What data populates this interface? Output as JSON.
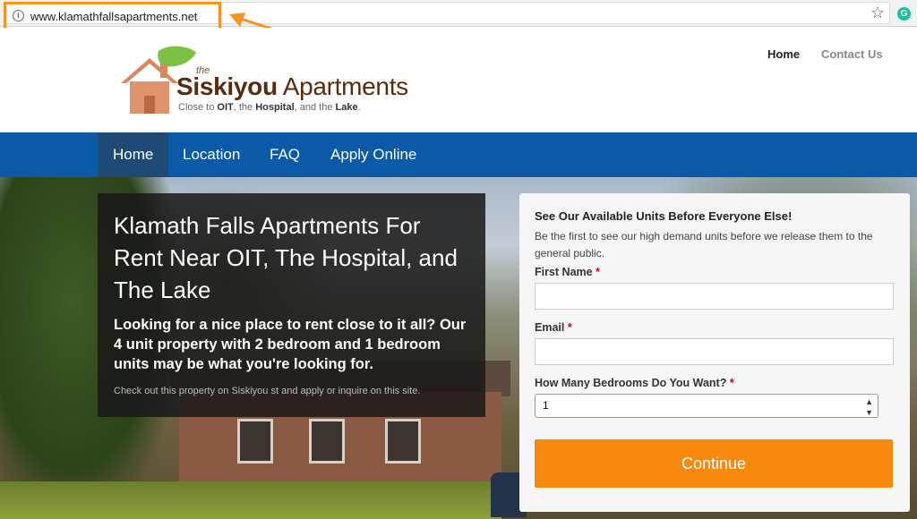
{
  "browser": {
    "url": "www.klamathfallsapartments.net",
    "info_icon": "i",
    "bookmark_icon": "☆",
    "extension_icon": "G"
  },
  "logo": {
    "the": "the",
    "name_bold": "Siskiyou",
    "name_rest": " Apartments",
    "tagline_parts": [
      "Close to ",
      "OIT",
      ", the ",
      "Hospital",
      ", and the ",
      "Lake",
      "."
    ]
  },
  "top_nav": {
    "home": "Home",
    "contact": "Contact Us"
  },
  "main_nav": {
    "items": [
      "Home",
      "Location",
      "FAQ",
      "Apply Online"
    ],
    "active_index": 0
  },
  "intro": {
    "title": "Klamath Falls Apartments For Rent Near OIT, The Hospital, and The Lake",
    "subtitle": "Looking for a nice place to rent close to it all? Our 4 unit property with 2 bedroom and 1 bedroom units may be what you're looking for.",
    "small": "Check out this property on Siskiyou st and apply or inquire on this site."
  },
  "form": {
    "title": "See Our Available Units Before Everyone Else!",
    "description": "Be the first to see our high demand units before we release them to the general public.",
    "first_name_label": "First Name",
    "email_label": "Email",
    "bedrooms_label": "How Many Bedrooms Do You Want?",
    "required_mark": "*",
    "bedrooms_value": "1",
    "submit": "Continue"
  },
  "colors": {
    "nav_blue": "#0a5aa8",
    "nav_active": "#1e4a75",
    "button_orange": "#f7890e",
    "annotation_orange": "#f5931f"
  }
}
